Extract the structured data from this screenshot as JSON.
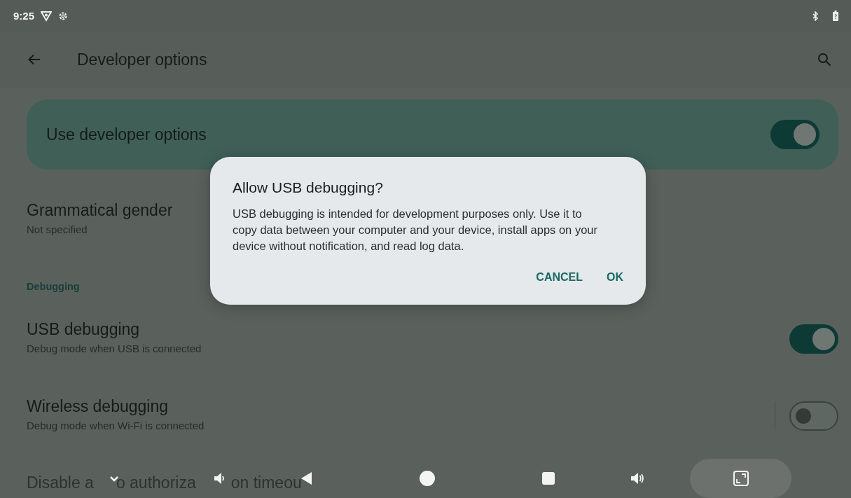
{
  "status_bar": {
    "time": "9:25"
  },
  "app_bar": {
    "title": "Developer options"
  },
  "main_switch": {
    "label": "Use developer options",
    "on": true
  },
  "settings": [
    {
      "kind": "item",
      "title": "Grammatical gender",
      "summary": "Not specified"
    },
    {
      "kind": "header",
      "title": "Debugging"
    },
    {
      "kind": "switch",
      "title": "USB debugging",
      "summary": "Debug mode when USB is connected",
      "on": true,
      "divider": false
    },
    {
      "kind": "switch",
      "title": "Wireless debugging",
      "summary": "Debug mode when Wi-Fi is connected",
      "on": false,
      "divider": true
    },
    {
      "kind": "covered",
      "fragments": [
        "Disable a",
        "o authoriza",
        "on timeou"
      ]
    }
  ],
  "dialog": {
    "title": "Allow USB debugging?",
    "message": "USB debugging is intended for development purposes only. Use it to copy data between your computer and your device, install apps on your device without notification, and read log data.",
    "buttons": [
      "CANCEL",
      "OK"
    ]
  }
}
